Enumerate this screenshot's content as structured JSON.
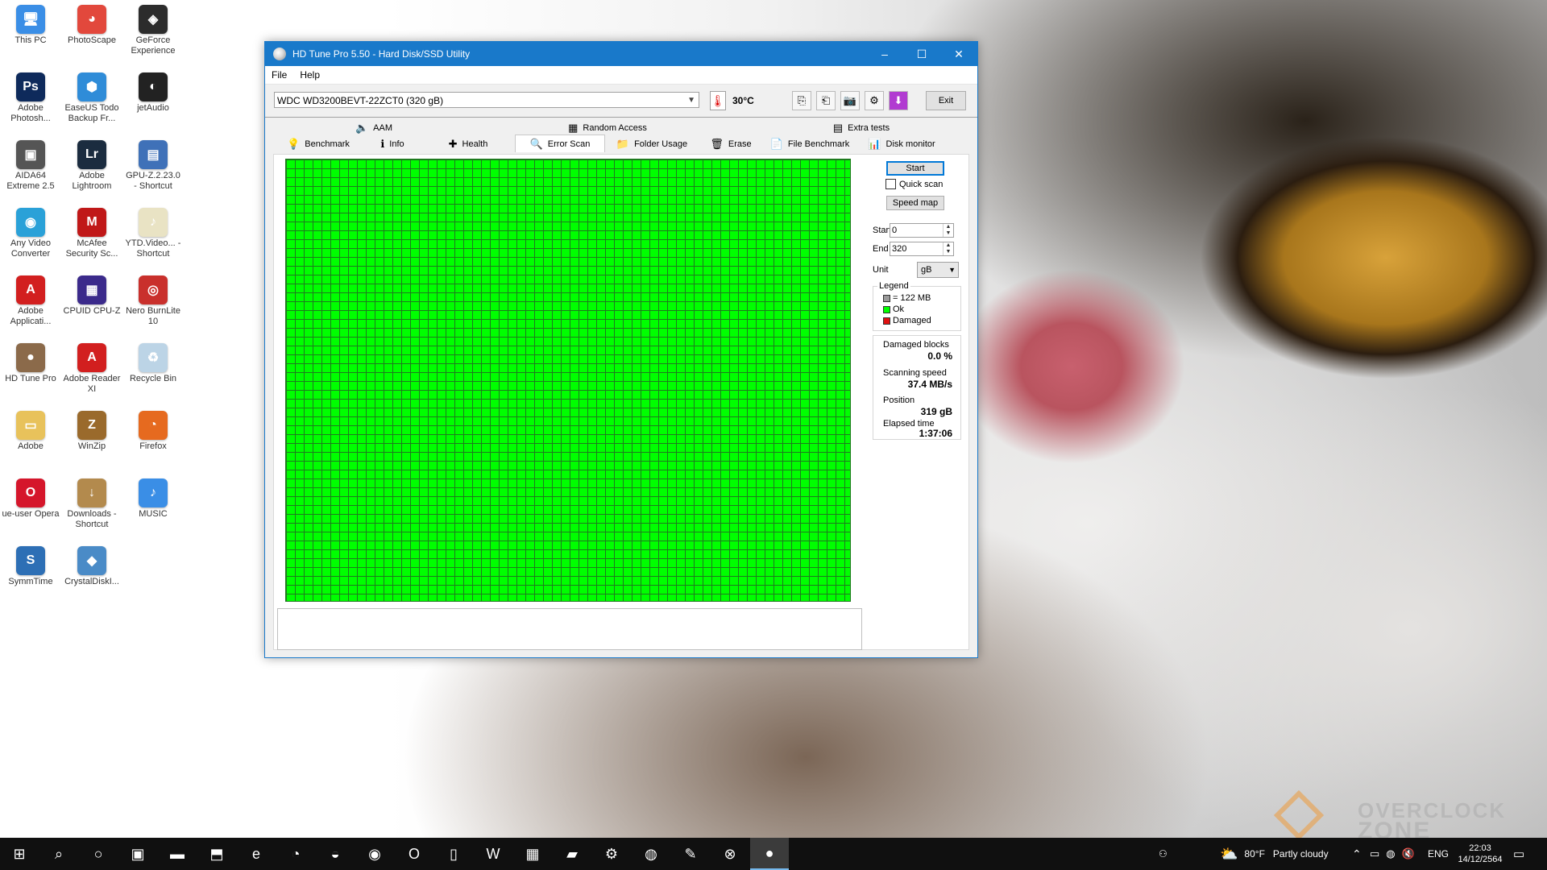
{
  "desktop": {
    "icons": [
      {
        "label": "This PC",
        "icon": "computer-icon",
        "glyph": "🖥",
        "color": "#3a8ee6"
      },
      {
        "label": "PhotoScape",
        "icon": "photoscape-icon",
        "glyph": "◕",
        "color": "#e2483c"
      },
      {
        "label": "GeForce Experience",
        "icon": "geforce-icon",
        "glyph": "◈",
        "color": "#2c2c2c"
      },
      {
        "label": "Adobe Photosh...",
        "icon": "photoshop-icon",
        "glyph": "Ps",
        "color": "#0e2a5b"
      },
      {
        "label": "EaseUS Todo Backup Fr...",
        "icon": "easeus-icon",
        "glyph": "⬢",
        "color": "#2f8cd8"
      },
      {
        "label": "jetAudio",
        "icon": "jetaudio-icon",
        "glyph": "◐",
        "color": "#222222"
      },
      {
        "label": "AIDA64 Extreme 2.5",
        "icon": "aida-icon",
        "glyph": "▣",
        "color": "#555555"
      },
      {
        "label": "Adobe Lightroom",
        "icon": "lightroom-icon",
        "glyph": "Lr",
        "color": "#1b2c3f"
      },
      {
        "label": "GPU-Z.2.23.0 - Shortcut",
        "icon": "gpuz-icon",
        "glyph": "▤",
        "color": "#3f71b8"
      },
      {
        "label": "Any Video Converter",
        "icon": "video-converter-icon",
        "glyph": "◉",
        "color": "#2aa1d8"
      },
      {
        "label": "McAfee Security Sc...",
        "icon": "mcafee-icon",
        "glyph": "M",
        "color": "#c01818"
      },
      {
        "label": "YTD.Video... - Shortcut",
        "icon": "ytd-icon",
        "glyph": "♪",
        "color": "#e9e3c4"
      },
      {
        "label": "Adobe Applicati...",
        "icon": "adobe-app-icon",
        "glyph": "A",
        "color": "#d21f1f"
      },
      {
        "label": "CPUID CPU-Z",
        "icon": "cpuz-icon",
        "glyph": "▦",
        "color": "#3b2a8b"
      },
      {
        "label": "Nero BurnLite 10",
        "icon": "nero-icon",
        "glyph": "◎",
        "color": "#c9302c"
      },
      {
        "label": "HD Tune Pro",
        "icon": "hdtune-icon",
        "glyph": "●",
        "color": "#8b6a4a"
      },
      {
        "label": "Adobe Reader XI",
        "icon": "adobe-reader-icon",
        "glyph": "A",
        "color": "#d21f1f"
      },
      {
        "label": "Recycle Bin",
        "icon": "recycle-bin-icon",
        "glyph": "♻",
        "color": "#bcd4e6"
      },
      {
        "label": "Adobe",
        "icon": "folder-icon",
        "glyph": "▭",
        "color": "#e8c25b"
      },
      {
        "label": "WinZip",
        "icon": "winzip-icon",
        "glyph": "Z",
        "color": "#9a6a2c"
      },
      {
        "label": "Firefox",
        "icon": "firefox-icon",
        "glyph": "◔",
        "color": "#e66a1f"
      },
      {
        "label": "ue-user Opera",
        "icon": "opera-icon",
        "glyph": "O",
        "color": "#d5162b"
      },
      {
        "label": "Downloads - Shortcut",
        "icon": "downloads-icon",
        "glyph": "↓",
        "color": "#b38a4d"
      },
      {
        "label": "MUSIC",
        "icon": "music-icon",
        "glyph": "♪",
        "color": "#3a8ee6"
      },
      {
        "label": "SymmTime",
        "icon": "symmtime-icon",
        "glyph": "S",
        "color": "#2d6fb5"
      },
      {
        "label": "CrystalDiskI...",
        "icon": "crystaldisk-icon",
        "glyph": "◆",
        "color": "#4a8bc7"
      }
    ]
  },
  "window": {
    "title": "HD Tune Pro 5.50 - Hard Disk/SSD Utility",
    "minimize": "–",
    "maximize": "☐",
    "close": "✕",
    "menu": [
      "File",
      "Help"
    ],
    "drive": "WDC WD3200BEVT-22ZCT0 (320 gB)",
    "temperature": "30°C",
    "exit_label": "Exit",
    "tabs_top": [
      {
        "label": "AAM",
        "icon": "speaker-icon",
        "glyph": "🔈"
      },
      {
        "label": "Random Access",
        "icon": "random-access-icon",
        "glyph": "▦"
      },
      {
        "label": "Extra tests",
        "icon": "extra-tests-icon",
        "glyph": "▤"
      }
    ],
    "tabs_bottom": [
      {
        "label": "Benchmark",
        "icon": "benchmark-icon",
        "glyph": "💡"
      },
      {
        "label": "Info",
        "icon": "info-icon",
        "glyph": "ℹ"
      },
      {
        "label": "Health",
        "icon": "health-icon",
        "glyph": "✚"
      },
      {
        "label": "Error Scan",
        "icon": "magnifier-icon",
        "glyph": "🔍"
      },
      {
        "label": "Folder Usage",
        "icon": "folder-icon",
        "glyph": "📁"
      },
      {
        "label": "Erase",
        "icon": "trash-icon",
        "glyph": "🗑"
      },
      {
        "label": "File Benchmark",
        "icon": "file-benchmark-icon",
        "glyph": "📄"
      },
      {
        "label": "Disk monitor",
        "icon": "disk-monitor-icon",
        "glyph": "📊"
      }
    ],
    "active_tab": "Error Scan"
  },
  "scan": {
    "start_button": "Start",
    "quick_scan_label": "Quick scan",
    "quick_scan_checked": false,
    "speed_map_button": "Speed map",
    "start_label": "Start",
    "start_value": "0",
    "end_label": "End",
    "end_value": "320",
    "unit_label": "Unit",
    "unit_value": "gB",
    "legend_title": "Legend",
    "legend": [
      {
        "label": "= 122 MB",
        "color": "#9a9a9a"
      },
      {
        "label": "Ok",
        "color": "#00ff00"
      },
      {
        "label": "Damaged",
        "color": "#e01010"
      }
    ],
    "stats": {
      "damaged_label": "Damaged blocks",
      "damaged_value": "0.0 %",
      "speed_label": "Scanning speed",
      "speed_value": "37.4 MB/s",
      "position_label": "Position",
      "position_value": "319 gB",
      "elapsed_label": "Elapsed time",
      "elapsed_value": "1:37:06"
    },
    "block_color_ok": "#00ff00",
    "grid_line_color": "#1f7a1f"
  },
  "taskbar": {
    "apps": [
      {
        "icon": "windows-start-icon",
        "glyph": "⊞"
      },
      {
        "icon": "search-icon",
        "glyph": "⌕"
      },
      {
        "icon": "cortana-icon",
        "glyph": "○"
      },
      {
        "icon": "store-icon",
        "glyph": "▣"
      },
      {
        "icon": "file-explorer-icon",
        "glyph": "▬"
      },
      {
        "icon": "network-icon",
        "glyph": "⬒"
      },
      {
        "icon": "ie-icon",
        "glyph": "e"
      },
      {
        "icon": "firefox-icon",
        "glyph": "◔"
      },
      {
        "icon": "edge-icon",
        "glyph": "◒"
      },
      {
        "icon": "chrome-icon",
        "glyph": "◉"
      },
      {
        "icon": "opera-icon",
        "glyph": "O"
      },
      {
        "icon": "document-icon",
        "glyph": "▯"
      },
      {
        "icon": "word-icon",
        "glyph": "W"
      },
      {
        "icon": "calculator-icon",
        "glyph": "▦"
      },
      {
        "icon": "window-icon",
        "glyph": "▰"
      },
      {
        "icon": "settings-icon",
        "glyph": "⚙"
      },
      {
        "icon": "globe-icon",
        "glyph": "◍"
      },
      {
        "icon": "paint-icon",
        "glyph": "✎"
      },
      {
        "icon": "xbox-icon",
        "glyph": "⊗"
      },
      {
        "icon": "hdtune-icon",
        "glyph": "●"
      }
    ],
    "weather_icon": "weather-icon",
    "weather_glyph": "⛅",
    "weather_temp": "80°F",
    "weather_text": "Partly cloudy",
    "language": "ENG",
    "time": "22:03",
    "date": "14/12/2564"
  },
  "watermark": {
    "line1": "OVERCLOCK",
    "line2": "ZONE"
  }
}
